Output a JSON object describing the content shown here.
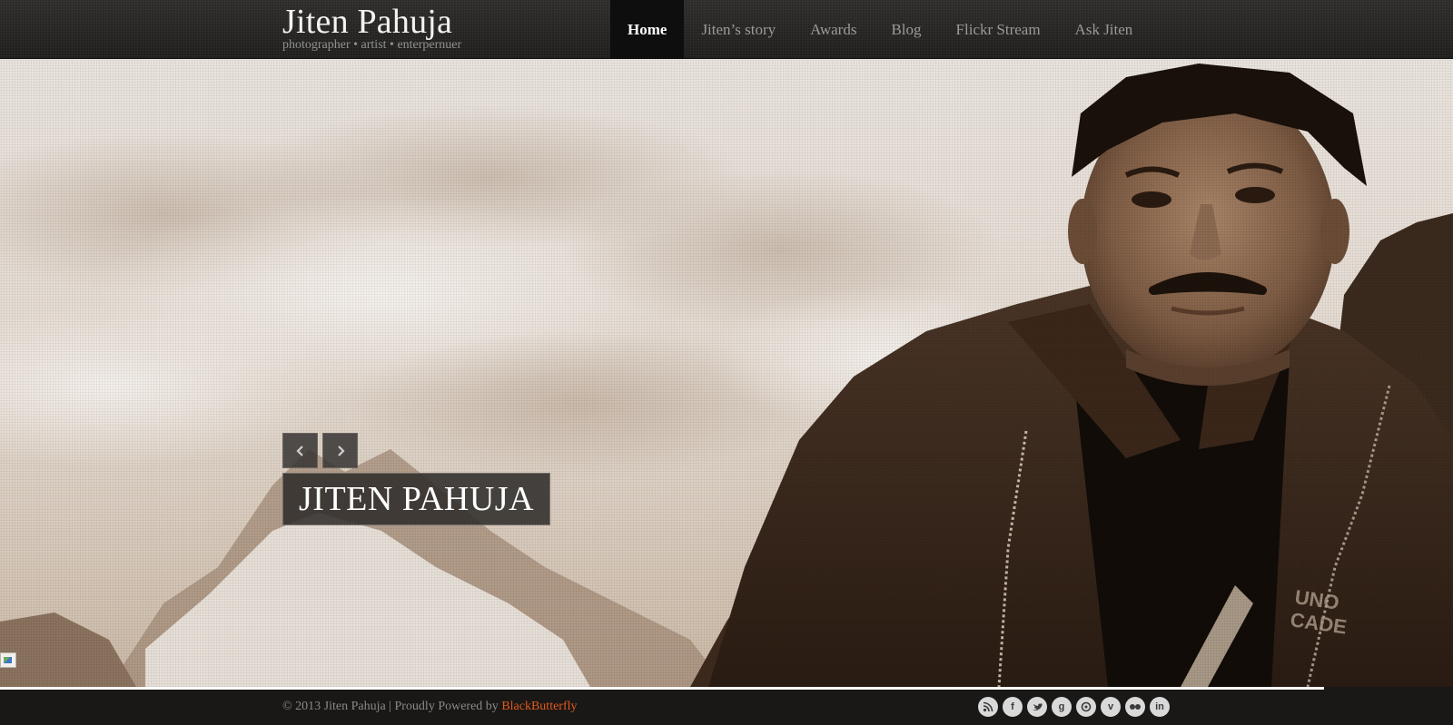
{
  "brand": {
    "title": "Jiten Pahuja",
    "tagline": "photographer • artist • enterpernuer"
  },
  "nav": {
    "items": [
      {
        "label": "Home",
        "active": true
      },
      {
        "label": "Jiten’s story",
        "active": false
      },
      {
        "label": "Awards",
        "active": false
      },
      {
        "label": "Blog",
        "active": false
      },
      {
        "label": "Flickr Stream",
        "active": false
      },
      {
        "label": "Ask Jiten",
        "active": false
      }
    ]
  },
  "hero": {
    "caption": "JITEN PAHUJA",
    "prev_icon": "chevron-left-icon",
    "next_icon": "chevron-right-icon"
  },
  "footer": {
    "copyright": "© 2013 Jiten Pahuja | Proudly Powered by ",
    "powered_link": "BlackButterfly",
    "link_color": "#e05a1e",
    "social": [
      {
        "name": "rss-icon"
      },
      {
        "name": "facebook-icon",
        "glyph": "f"
      },
      {
        "name": "twitter-icon"
      },
      {
        "name": "google-plus-icon",
        "glyph": "g"
      },
      {
        "name": "picasa-icon"
      },
      {
        "name": "vimeo-icon",
        "glyph": "v"
      },
      {
        "name": "flickr-icon"
      },
      {
        "name": "linkedin-icon",
        "glyph": "in"
      }
    ]
  }
}
